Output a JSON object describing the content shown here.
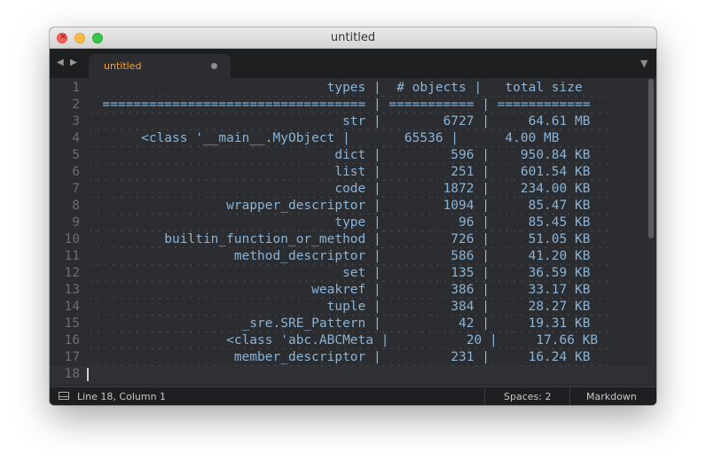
{
  "window": {
    "title": "untitled"
  },
  "tabs": [
    {
      "label": "untitled"
    }
  ],
  "editor": {
    "lines": [
      {
        "num": "1",
        "text": "                               types |  # objects |   total size"
      },
      {
        "num": "2",
        "text": "  ================================== | =========== | ============"
      },
      {
        "num": "3",
        "text": "                                 str |        6727 |     64.61 MB"
      },
      {
        "num": "4",
        "text": "       <class '__main__.MyObject |       65536 |      4.00 MB"
      },
      {
        "num": "5",
        "text": "                                dict |         596 |    950.84 KB"
      },
      {
        "num": "6",
        "text": "                                list |         251 |    601.54 KB"
      },
      {
        "num": "7",
        "text": "                                code |        1872 |    234.00 KB"
      },
      {
        "num": "8",
        "text": "                  wrapper_descriptor |        1094 |     85.47 KB"
      },
      {
        "num": "9",
        "text": "                                type |          96 |     85.45 KB"
      },
      {
        "num": "10",
        "text": "          builtin_function_or_method |         726 |     51.05 KB"
      },
      {
        "num": "11",
        "text": "                   method_descriptor |         586 |     41.20 KB"
      },
      {
        "num": "12",
        "text": "                                 set |         135 |     36.59 KB"
      },
      {
        "num": "13",
        "text": "                             weakref |         386 |     33.17 KB"
      },
      {
        "num": "14",
        "text": "                               tuple |         384 |     28.27 KB"
      },
      {
        "num": "15",
        "text": "                    _sre.SRE_Pattern |          42 |     19.31 KB"
      },
      {
        "num": "16",
        "text": "                  <class 'abc.ABCMeta |          20 |     17.66 KB"
      },
      {
        "num": "17",
        "text": "                   member_descriptor |         231 |     16.24 KB"
      },
      {
        "num": "18",
        "text": ""
      }
    ]
  },
  "status": {
    "position": "Line 18, Column 1",
    "spaces": "Spaces: 2",
    "syntax": "Markdown"
  },
  "colors": {
    "tab_label": "#f0a23c",
    "code_text": "#8ab4d8",
    "editor_bg": "#2b2d30"
  }
}
